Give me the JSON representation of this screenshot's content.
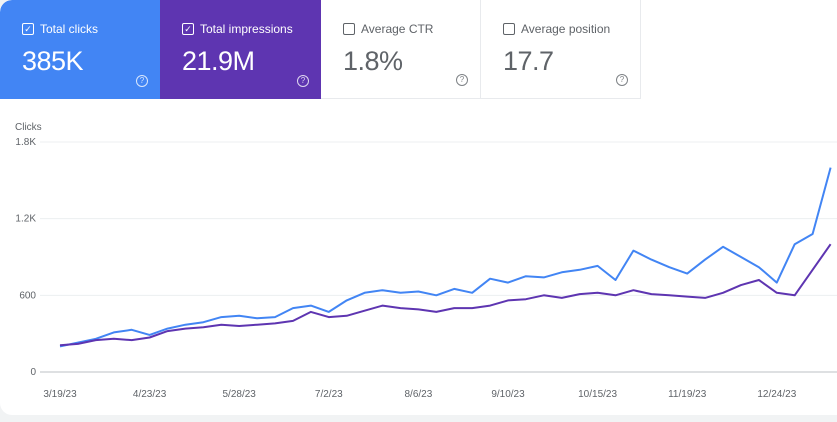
{
  "cards": [
    {
      "label": "Total clicks",
      "value": "385K",
      "checked": true,
      "color": "#4285f4"
    },
    {
      "label": "Total impressions",
      "value": "21.9M",
      "checked": true,
      "color": "#5e35b1"
    },
    {
      "label": "Average CTR",
      "value": "1.8%",
      "checked": false
    },
    {
      "label": "Average position",
      "value": "17.7",
      "checked": false
    }
  ],
  "chart_data": {
    "type": "line",
    "ylabel": "Clicks",
    "ylim": [
      0,
      1800
    ],
    "yticks": [
      "0",
      "600",
      "1.2K",
      "1.8K"
    ],
    "ytick_values": [
      0,
      600,
      1200,
      1800
    ],
    "xticks": [
      "3/19/23",
      "4/23/23",
      "5/28/23",
      "7/2/23",
      "8/6/23",
      "9/10/23",
      "10/15/23",
      "11/19/23",
      "12/24/23"
    ],
    "x": [
      "3/19/23",
      "3/26/23",
      "4/2/23",
      "4/9/23",
      "4/16/23",
      "4/23/23",
      "4/30/23",
      "5/7/23",
      "5/14/23",
      "5/21/23",
      "5/28/23",
      "6/4/23",
      "6/11/23",
      "6/18/23",
      "6/25/23",
      "7/2/23",
      "7/9/23",
      "7/16/23",
      "7/23/23",
      "7/30/23",
      "8/6/23",
      "8/13/23",
      "8/20/23",
      "8/27/23",
      "9/3/23",
      "9/10/23",
      "9/17/23",
      "9/24/23",
      "10/1/23",
      "10/8/23",
      "10/15/23",
      "10/22/23",
      "10/29/23",
      "11/5/23",
      "11/12/23",
      "11/19/23",
      "11/26/23",
      "12/3/23",
      "12/10/23",
      "12/17/23",
      "12/24/23",
      "12/31/23",
      "1/7/24",
      "1/14/24"
    ],
    "grid": true,
    "series": [
      {
        "color": "#4285f4",
        "values": [
          200,
          230,
          260,
          310,
          330,
          290,
          340,
          370,
          390,
          430,
          440,
          420,
          430,
          500,
          520,
          470,
          560,
          620,
          640,
          620,
          630,
          600,
          650,
          620,
          730,
          700,
          750,
          740,
          780,
          800,
          830,
          720,
          950,
          880,
          820,
          770,
          880,
          980,
          900,
          820,
          700,
          1000,
          1080,
          1600
        ]
      },
      {
        "color": "#5e35b1",
        "values": [
          210,
          220,
          250,
          260,
          250,
          270,
          320,
          340,
          350,
          370,
          360,
          370,
          380,
          400,
          470,
          430,
          440,
          480,
          520,
          500,
          490,
          470,
          500,
          500,
          520,
          560,
          570,
          600,
          580,
          610,
          620,
          600,
          640,
          610,
          600,
          590,
          580,
          620,
          680,
          720,
          620,
          600,
          800,
          1000
        ]
      }
    ]
  }
}
